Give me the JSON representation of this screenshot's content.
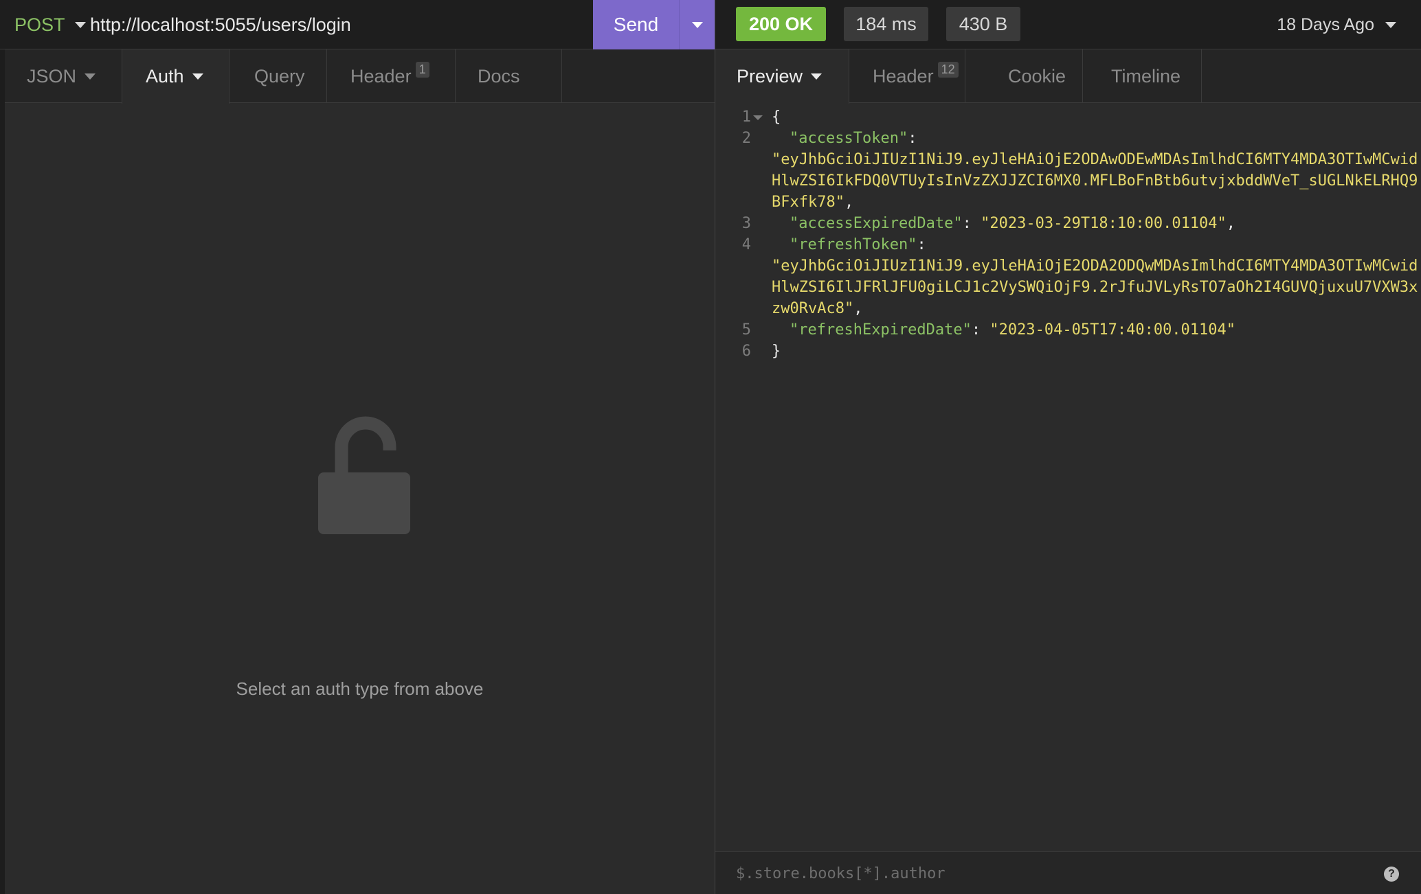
{
  "request": {
    "method": "POST",
    "url": "http://localhost:5055/users/login",
    "send_label": "Send",
    "tabs": [
      {
        "label": "JSON"
      },
      {
        "label": "Auth"
      },
      {
        "label": "Query"
      },
      {
        "label": "Header",
        "badge": "1"
      },
      {
        "label": "Docs"
      }
    ],
    "auth_message": "Select an auth type from above"
  },
  "response": {
    "status": "200 OK",
    "time": "184 ms",
    "size": "430 B",
    "age": "18 Days Ago",
    "tabs": [
      {
        "label": "Preview"
      },
      {
        "label": "Header",
        "badge": "12"
      },
      {
        "label": "Cookie"
      },
      {
        "label": "Timeline"
      }
    ],
    "body": {
      "open_brace": "{",
      "close_brace": "}",
      "access_token_key": "\"accessToken\"",
      "access_token_lines": [
        "\"eyJhbGciOiJIUzI1NiJ9.eyJleHAiOjE2ODAwODEwMDAsImlhdCI6MTY4MDA3OTIwMCwid",
        "HlwZSI6IkFDQ0VTUyIsInVzZXJJZCI6MX0.MFLBoFnBtb6utvjxbddWVeT_sUGLNkELRHQ9",
        "BFxfk78\""
      ],
      "access_expired_key": "\"accessExpiredDate\"",
      "access_expired_value": "\"2023-03-29T18:10:00.01104\"",
      "refresh_token_key": "\"refreshToken\"",
      "refresh_token_lines": [
        "\"eyJhbGciOiJIUzI1NiJ9.eyJleHAiOjE2ODA2ODQwMDAsImlhdCI6MTY4MDA3OTIwMCwid",
        "HlwZSI6IlJFRlJFU0giLCJ1c2VySWQiOjF9.2rJfuJVLyRsTO7aOh2I4GUVQjuxuU7VXW3x",
        "zw0RvAc8\""
      ],
      "refresh_expired_key": "\"refreshExpiredDate\"",
      "refresh_expired_value": "\"2023-04-05T17:40:00.01104\""
    },
    "line_numbers": [
      "1",
      "2",
      "3",
      "4",
      "5",
      "6"
    ],
    "filter_placeholder": "$.store.books[*].author",
    "help_glyph": "?"
  },
  "colors": {
    "send_button": "#7d69cb",
    "status_ok": "#74b83e",
    "method_post": "#8cc265",
    "json_key": "#8cc265",
    "json_string": "#e6d96b"
  },
  "icons": {
    "auth_empty": "unlocked-padlock-icon",
    "dropdown": "caret-down-icon",
    "help": "question-circle-icon"
  }
}
